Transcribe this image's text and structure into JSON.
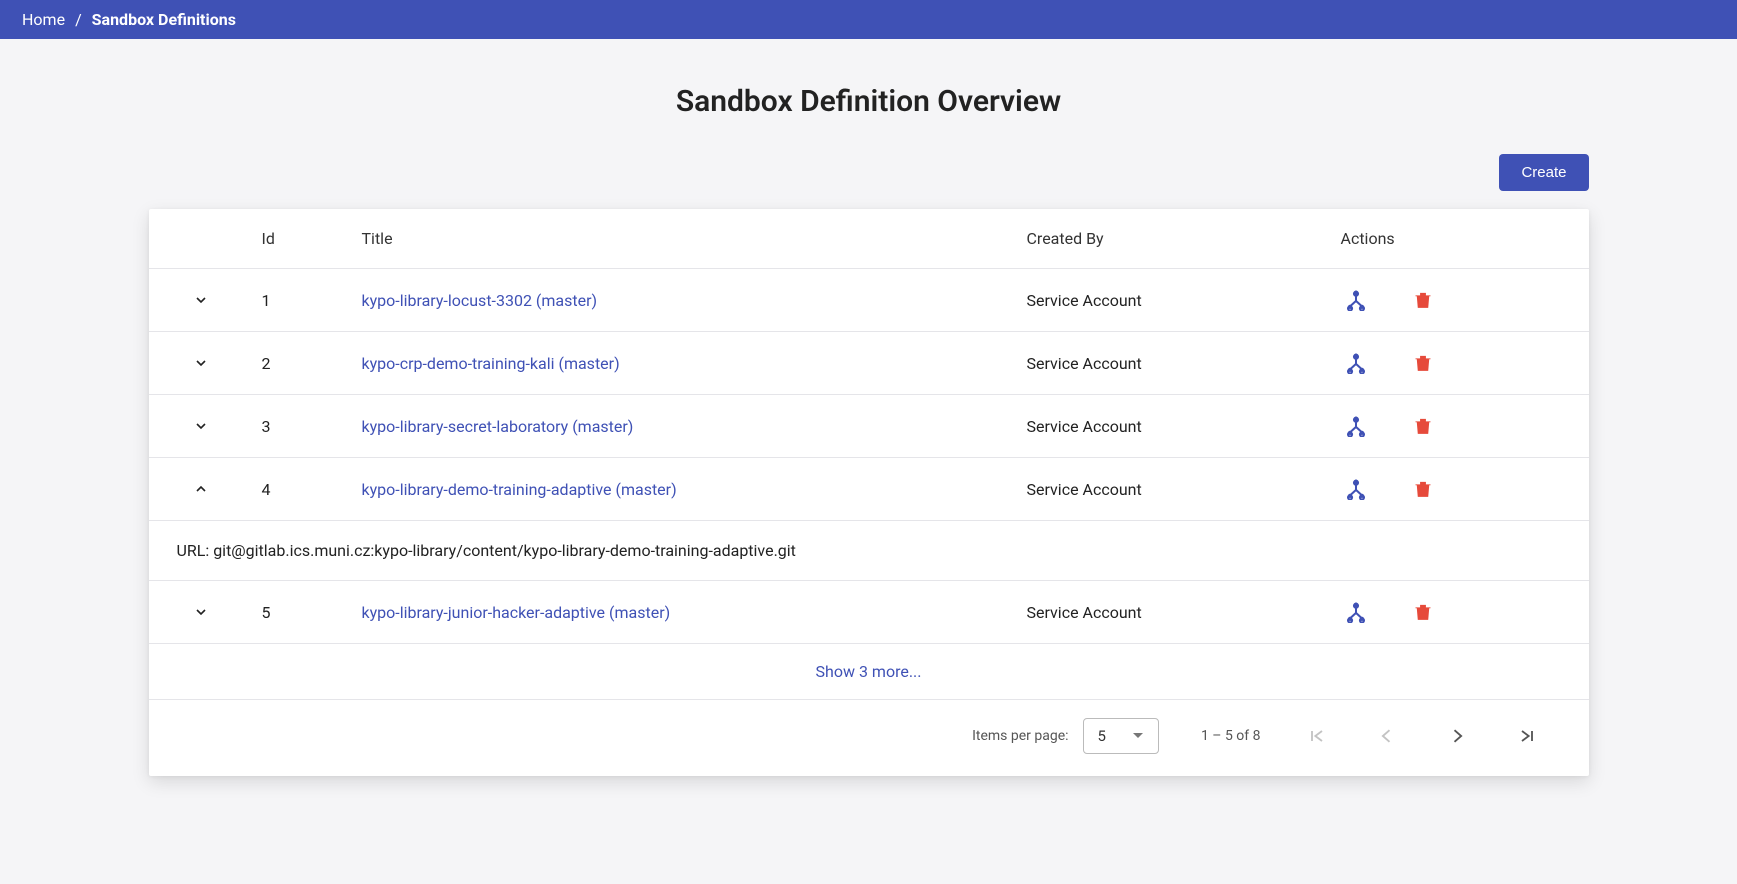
{
  "breadcrumb": {
    "home": "Home",
    "current": "Sandbox Definitions"
  },
  "page": {
    "title": "Sandbox Definition Overview",
    "create_button": "Create"
  },
  "table": {
    "headers": {
      "id": "Id",
      "title": "Title",
      "created_by": "Created By",
      "actions": "Actions"
    },
    "rows": [
      {
        "expanded": false,
        "id": "1",
        "title": "kypo-library-locust-3302 (master)",
        "created_by": "Service Account"
      },
      {
        "expanded": false,
        "id": "2",
        "title": "kypo-crp-demo-training-kali (master)",
        "created_by": "Service Account"
      },
      {
        "expanded": false,
        "id": "3",
        "title": "kypo-library-secret-laboratory (master)",
        "created_by": "Service Account"
      },
      {
        "expanded": true,
        "id": "4",
        "title": "kypo-library-demo-training-adaptive (master)",
        "created_by": "Service Account",
        "detail": "URL: git@gitlab.ics.muni.cz:kypo-library/content/kypo-library-demo-training-adaptive.git"
      },
      {
        "expanded": false,
        "id": "5",
        "title": "kypo-library-junior-hacker-adaptive (master)",
        "created_by": "Service Account"
      }
    ],
    "show_more": "Show 3 more..."
  },
  "paginator": {
    "items_per_page_label": "Items per page:",
    "page_size": "5",
    "range_label": "1 – 5 of 8"
  }
}
